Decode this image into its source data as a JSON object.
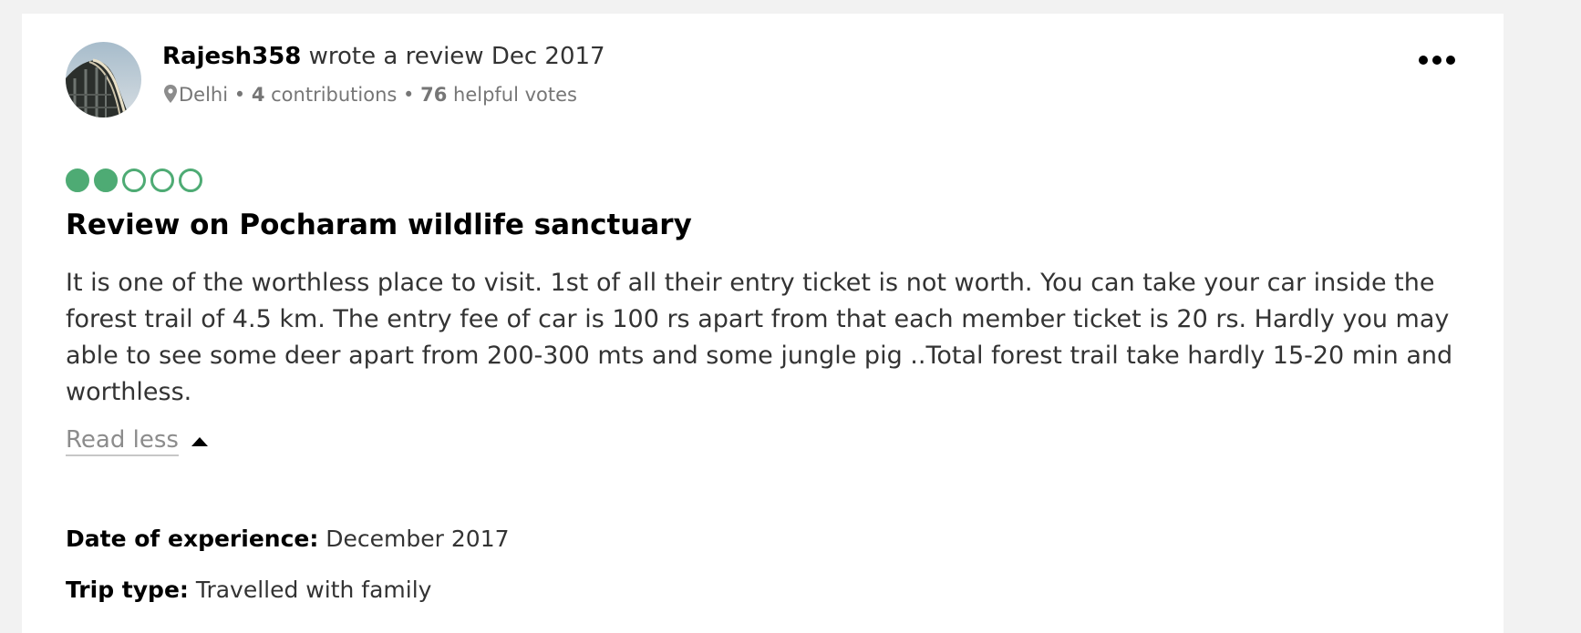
{
  "review": {
    "author": {
      "username": "Rajesh358",
      "action": " wrote a review Dec 2017",
      "location": "Delhi",
      "separator": " • ",
      "contributions_count": "4",
      "contributions_label": " contributions",
      "helpful_count": "76",
      "helpful_label": " helpful votes"
    },
    "rating": {
      "value": 2,
      "max": 5
    },
    "title": "Review on Pocharam wildlife sanctuary",
    "body": "It is one of the worthless place to visit. 1st of all their entry ticket is not worth. You can take your car inside the forest trail of 4.5 km. The entry fee of car is 100 rs apart from that each member ticket is 20 rs. Hardly you may able to see some deer apart from 200-300 mts and some jungle pig ..Total forest trail take hardly 15-20 min and worthless.",
    "read_less_label": "Read less",
    "details": {
      "date_label": "Date of experience:",
      "date_value": " December 2017",
      "trip_label": "Trip type:",
      "trip_value": " Travelled with family"
    }
  },
  "colors": {
    "bubble": "#4eab74",
    "muted_text": "#767676",
    "body_text": "#333333"
  },
  "icons": {
    "more": "more-horizontal-icon",
    "location": "map-pin-icon",
    "read_less": "caret-up-icon"
  }
}
